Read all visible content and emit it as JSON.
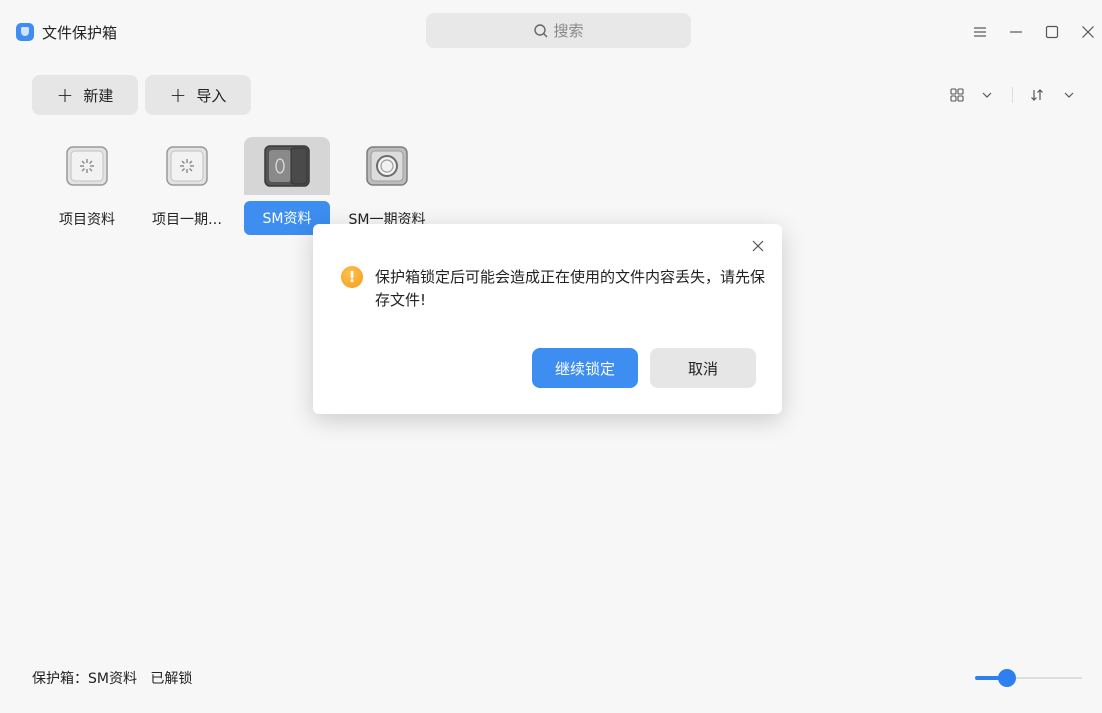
{
  "app": {
    "title": "文件保护箱"
  },
  "search": {
    "placeholder": "搜索"
  },
  "toolbar": {
    "new_label": "新建",
    "import_label": "导入"
  },
  "vaults": [
    {
      "name": "项目资料",
      "icon": "vault-locked-icon",
      "selected": false
    },
    {
      "name": "项目一期…",
      "icon": "vault-locked-icon",
      "selected": false
    },
    {
      "name": "SM资料",
      "icon": "vault-open-icon",
      "selected": true
    },
    {
      "name": "SM一期资料",
      "icon": "vault-dial-icon",
      "selected": false
    }
  ],
  "dialog": {
    "message": "保护箱锁定后可能会造成正在使用的文件内容丢失，请先保存文件!",
    "confirm_label": "继续锁定",
    "cancel_label": "取消"
  },
  "status": {
    "text": "保护箱：SM资料   已解锁"
  },
  "zoom": {
    "level": 0.3
  },
  "colors": {
    "accent": "#3d8ef0",
    "warning": "#f59b1a"
  }
}
